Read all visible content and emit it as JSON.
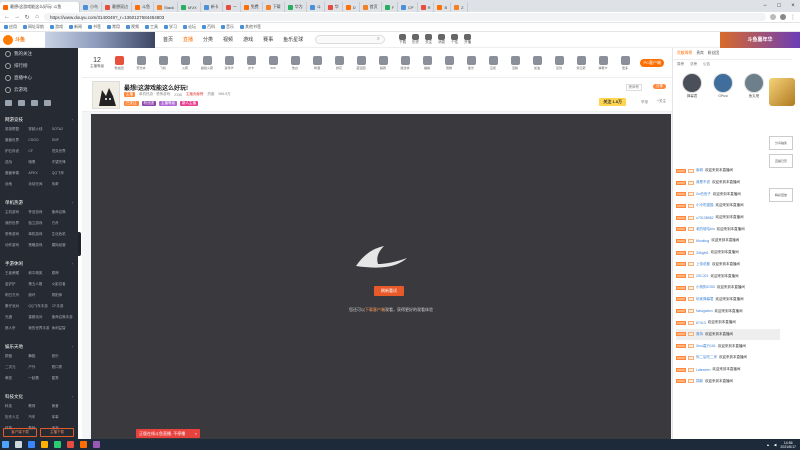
{
  "browser": {
    "active_tab": "最想!这游戏能这么好玩! 斗鱼",
    "tabs": [
      "小鸟",
      "最想双边",
      "斗鱼",
      "Stack",
      "MVX",
      "新卡",
      "一",
      "免费",
      "下载",
      "华为",
      "斗",
      "华",
      "D",
      "首页",
      "F",
      "CP",
      "R",
      "B",
      "Z"
    ],
    "url": "https://www.douyu.com/3140049?_r=1360127584454803",
    "bookmarks": [
      "应用",
      "网址导航",
      "游戏",
      "新闻",
      "书签",
      "常用",
      "视频",
      "工具",
      "学习",
      "论坛",
      "百科",
      "音乐",
      "其他书签"
    ]
  },
  "site": {
    "logo": "斗鱼",
    "nav": [
      "首页",
      "直播",
      "分类",
      "视频",
      "游戏",
      "赛事",
      "鱼乐星球"
    ],
    "nav_active": "直播",
    "search_icon": "search-icon",
    "header_tools": [
      "下载",
      "历史",
      "关注",
      "消息",
      "个性",
      "开播"
    ],
    "right_banner": "斗鱼嘉年华"
  },
  "sidebar": {
    "top_items": [
      "我的关注",
      "排行榜",
      "直播中心",
      "云游戏"
    ],
    "sections": [
      {
        "title": "网游竞技",
        "items": [
          "英雄联盟",
          "穿越火线",
          "DOTA2",
          "魔兽世界",
          "CSGO",
          "DNF",
          "炉石传说",
          "CF",
          "坦克世界",
          "逆战",
          "暗黑",
          "守望先锋",
          "魔兽争霸",
          "APEX",
          "QQ飞车",
          "战地",
          "永劫无间",
          "传奇"
        ]
      },
      {
        "title": "单机热游",
        "items": [
          "主机游戏",
          "怀旧游戏",
          "使命召唤",
          "我的世界",
          "独立游戏",
          "方舟",
          "恐怖游戏",
          "单机游戏",
          "生化危机",
          "动作游戏",
          "策略游戏",
          "模拟经营"
        ]
      },
      {
        "title": "手游休闲",
        "items": [
          "王者荣耀",
          "和平精英",
          "原神",
          "金铲铲",
          "第五人格",
          "火影忍者",
          "明日方舟",
          "崩坏",
          "阴阳师",
          "蛋仔派对",
          "QQ飞车手游",
          "CF手游",
          "光遇",
          "香肠派对",
          "使命召唤手游",
          "狼人杀",
          "我的世界手游",
          "休闲益智"
        ]
      },
      {
        "title": "娱乐天地",
        "items": [
          "颜值",
          "舞蹈",
          "音乐",
          "二次元",
          "户外",
          "脱口秀",
          "萌宠",
          "一起看",
          "星秀"
        ]
      },
      {
        "title": "科技文化",
        "items": [
          "科技",
          "教育",
          "美食",
          "历史人文",
          "汽车",
          "军事",
          "体育",
          "数码",
          "读书"
        ]
      }
    ],
    "bottom_buttons": [
      "客户端下载",
      "主播下载"
    ]
  },
  "giftbar": {
    "count": "12",
    "count_label": "主播等级",
    "gifts": [
      "粉丝团",
      "荧光棒",
      "飞机",
      "火箭",
      "超级火箭",
      "嘉年华",
      "办卡",
      "666",
      "告白",
      "啤酒",
      "鲜花",
      "藏宝图",
      "超跑",
      "魔法棒",
      "福袋",
      "蛋糕",
      "星光",
      "应援",
      "宝箱",
      "加油",
      "签到",
      "穿云箭",
      "弹幕卡",
      "更多"
    ],
    "pc_button": "PC客户端"
  },
  "room": {
    "title": "最想!这游戏能这么好玩!",
    "category": "单机热游 · 恐怖游戏",
    "streamer_tag": "主播",
    "fans": "2136",
    "medal": "主播贡献榜",
    "hot": "热度",
    "hot_value": "986.5万",
    "tags": [
      "已关注",
      "粉丝团",
      "主播等级",
      "新人主播"
    ],
    "room_no": "房间号",
    "share": "分享",
    "follow": "关注 1.8万",
    "report": "举报",
    "follow2": "+关注"
  },
  "player": {
    "reload": "刷新重试",
    "message_prefix": "您还可以",
    "message_link": "下载客户端",
    "message_suffix": "观看，获得更好的观看体验"
  },
  "rightpanel": {
    "tabs": [
      "贡献周榜",
      "贵宾",
      "粉丝团"
    ],
    "active_tab": "贡献周榜",
    "subtabs": [
      "周榜",
      "总榜",
      "公告"
    ],
    "top_users": [
      "弹幕君",
      "GPusi",
      "鱼丸爸"
    ],
    "chat": [
      {
        "user": "南城",
        "text": "欢迎来到本直播间"
      },
      {
        "user": "我是不说",
        "text": "欢迎来到本直播间"
      },
      {
        "user": "Xu伯伯子",
        "text": "欢迎来到本直播间"
      },
      {
        "user": "小冷吃猫猫",
        "text": "欢迎来到本直播间"
      },
      {
        "user": "u73138982",
        "text": "欢迎来到本直播间"
      },
      {
        "user": "老的哈哈blu",
        "text": "欢迎来到本直播间"
      },
      {
        "user": "Monking",
        "text": "欢迎来到本直播间"
      },
      {
        "user": "346gbf1",
        "text": "欢迎来到本直播间"
      },
      {
        "user": "上帝说都",
        "text": "欢迎来到本直播间"
      },
      {
        "user": "2SCJ01",
        "text": "欢迎来到本直播间"
      },
      {
        "user": "小狗狗JO53",
        "text": "欢迎来到本直播间"
      },
      {
        "user": "玩家弹幕君",
        "text": "欢迎来到本直播间"
      },
      {
        "user": "Navigation",
        "text": "欢迎来到本直播间"
      },
      {
        "user": "67413",
        "text": "欢迎来到本直播间"
      },
      {
        "user": "奥特",
        "text": "欢迎来到本直播间"
      },
      {
        "user": "Xinu嘉行161",
        "text": "欢迎来到本直播间"
      },
      {
        "user": "你二后吃二来",
        "text": "欢迎来到本直播间"
      },
      {
        "user": "Latexeen",
        "text": "欢迎来到本直播间"
      },
      {
        "user": "捐款",
        "text": "欢迎来到本直播间"
      }
    ],
    "side_buttons": [
      "分享抽奖",
      "直播日历",
      "精彩回放"
    ]
  },
  "toast": {
    "text": "正版在线斗鱼直播, 不停播",
    "close": "×"
  },
  "taskbar": {
    "time": "14:56",
    "date": "2021/6/17"
  }
}
